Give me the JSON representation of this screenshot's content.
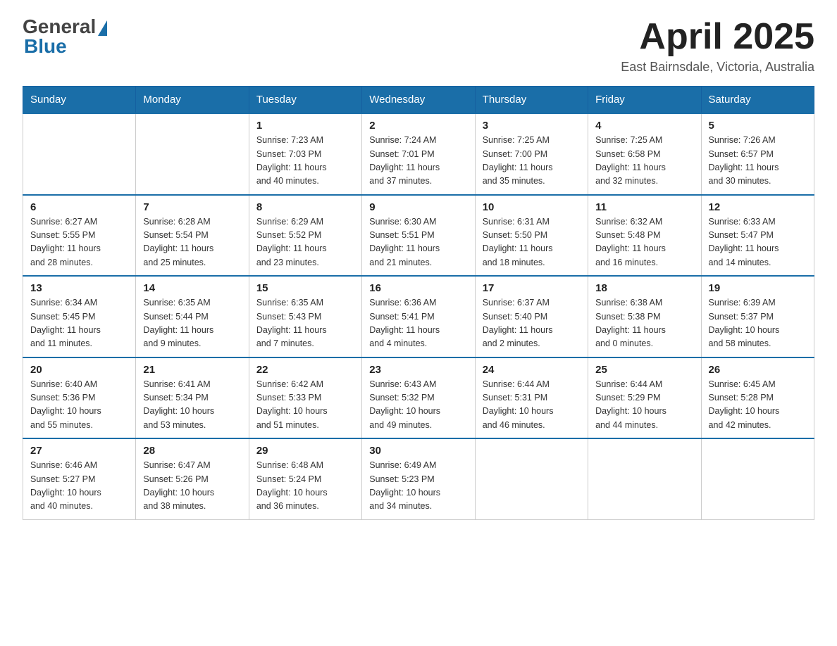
{
  "header": {
    "logo_general": "General",
    "logo_blue": "Blue",
    "month_title": "April 2025",
    "subtitle": "East Bairnsdale, Victoria, Australia"
  },
  "days_of_week": [
    "Sunday",
    "Monday",
    "Tuesday",
    "Wednesday",
    "Thursday",
    "Friday",
    "Saturday"
  ],
  "weeks": [
    [
      {
        "day": "",
        "info": ""
      },
      {
        "day": "",
        "info": ""
      },
      {
        "day": "1",
        "info": "Sunrise: 7:23 AM\nSunset: 7:03 PM\nDaylight: 11 hours\nand 40 minutes."
      },
      {
        "day": "2",
        "info": "Sunrise: 7:24 AM\nSunset: 7:01 PM\nDaylight: 11 hours\nand 37 minutes."
      },
      {
        "day": "3",
        "info": "Sunrise: 7:25 AM\nSunset: 7:00 PM\nDaylight: 11 hours\nand 35 minutes."
      },
      {
        "day": "4",
        "info": "Sunrise: 7:25 AM\nSunset: 6:58 PM\nDaylight: 11 hours\nand 32 minutes."
      },
      {
        "day": "5",
        "info": "Sunrise: 7:26 AM\nSunset: 6:57 PM\nDaylight: 11 hours\nand 30 minutes."
      }
    ],
    [
      {
        "day": "6",
        "info": "Sunrise: 6:27 AM\nSunset: 5:55 PM\nDaylight: 11 hours\nand 28 minutes."
      },
      {
        "day": "7",
        "info": "Sunrise: 6:28 AM\nSunset: 5:54 PM\nDaylight: 11 hours\nand 25 minutes."
      },
      {
        "day": "8",
        "info": "Sunrise: 6:29 AM\nSunset: 5:52 PM\nDaylight: 11 hours\nand 23 minutes."
      },
      {
        "day": "9",
        "info": "Sunrise: 6:30 AM\nSunset: 5:51 PM\nDaylight: 11 hours\nand 21 minutes."
      },
      {
        "day": "10",
        "info": "Sunrise: 6:31 AM\nSunset: 5:50 PM\nDaylight: 11 hours\nand 18 minutes."
      },
      {
        "day": "11",
        "info": "Sunrise: 6:32 AM\nSunset: 5:48 PM\nDaylight: 11 hours\nand 16 minutes."
      },
      {
        "day": "12",
        "info": "Sunrise: 6:33 AM\nSunset: 5:47 PM\nDaylight: 11 hours\nand 14 minutes."
      }
    ],
    [
      {
        "day": "13",
        "info": "Sunrise: 6:34 AM\nSunset: 5:45 PM\nDaylight: 11 hours\nand 11 minutes."
      },
      {
        "day": "14",
        "info": "Sunrise: 6:35 AM\nSunset: 5:44 PM\nDaylight: 11 hours\nand 9 minutes."
      },
      {
        "day": "15",
        "info": "Sunrise: 6:35 AM\nSunset: 5:43 PM\nDaylight: 11 hours\nand 7 minutes."
      },
      {
        "day": "16",
        "info": "Sunrise: 6:36 AM\nSunset: 5:41 PM\nDaylight: 11 hours\nand 4 minutes."
      },
      {
        "day": "17",
        "info": "Sunrise: 6:37 AM\nSunset: 5:40 PM\nDaylight: 11 hours\nand 2 minutes."
      },
      {
        "day": "18",
        "info": "Sunrise: 6:38 AM\nSunset: 5:38 PM\nDaylight: 11 hours\nand 0 minutes."
      },
      {
        "day": "19",
        "info": "Sunrise: 6:39 AM\nSunset: 5:37 PM\nDaylight: 10 hours\nand 58 minutes."
      }
    ],
    [
      {
        "day": "20",
        "info": "Sunrise: 6:40 AM\nSunset: 5:36 PM\nDaylight: 10 hours\nand 55 minutes."
      },
      {
        "day": "21",
        "info": "Sunrise: 6:41 AM\nSunset: 5:34 PM\nDaylight: 10 hours\nand 53 minutes."
      },
      {
        "day": "22",
        "info": "Sunrise: 6:42 AM\nSunset: 5:33 PM\nDaylight: 10 hours\nand 51 minutes."
      },
      {
        "day": "23",
        "info": "Sunrise: 6:43 AM\nSunset: 5:32 PM\nDaylight: 10 hours\nand 49 minutes."
      },
      {
        "day": "24",
        "info": "Sunrise: 6:44 AM\nSunset: 5:31 PM\nDaylight: 10 hours\nand 46 minutes."
      },
      {
        "day": "25",
        "info": "Sunrise: 6:44 AM\nSunset: 5:29 PM\nDaylight: 10 hours\nand 44 minutes."
      },
      {
        "day": "26",
        "info": "Sunrise: 6:45 AM\nSunset: 5:28 PM\nDaylight: 10 hours\nand 42 minutes."
      }
    ],
    [
      {
        "day": "27",
        "info": "Sunrise: 6:46 AM\nSunset: 5:27 PM\nDaylight: 10 hours\nand 40 minutes."
      },
      {
        "day": "28",
        "info": "Sunrise: 6:47 AM\nSunset: 5:26 PM\nDaylight: 10 hours\nand 38 minutes."
      },
      {
        "day": "29",
        "info": "Sunrise: 6:48 AM\nSunset: 5:24 PM\nDaylight: 10 hours\nand 36 minutes."
      },
      {
        "day": "30",
        "info": "Sunrise: 6:49 AM\nSunset: 5:23 PM\nDaylight: 10 hours\nand 34 minutes."
      },
      {
        "day": "",
        "info": ""
      },
      {
        "day": "",
        "info": ""
      },
      {
        "day": "",
        "info": ""
      }
    ]
  ]
}
